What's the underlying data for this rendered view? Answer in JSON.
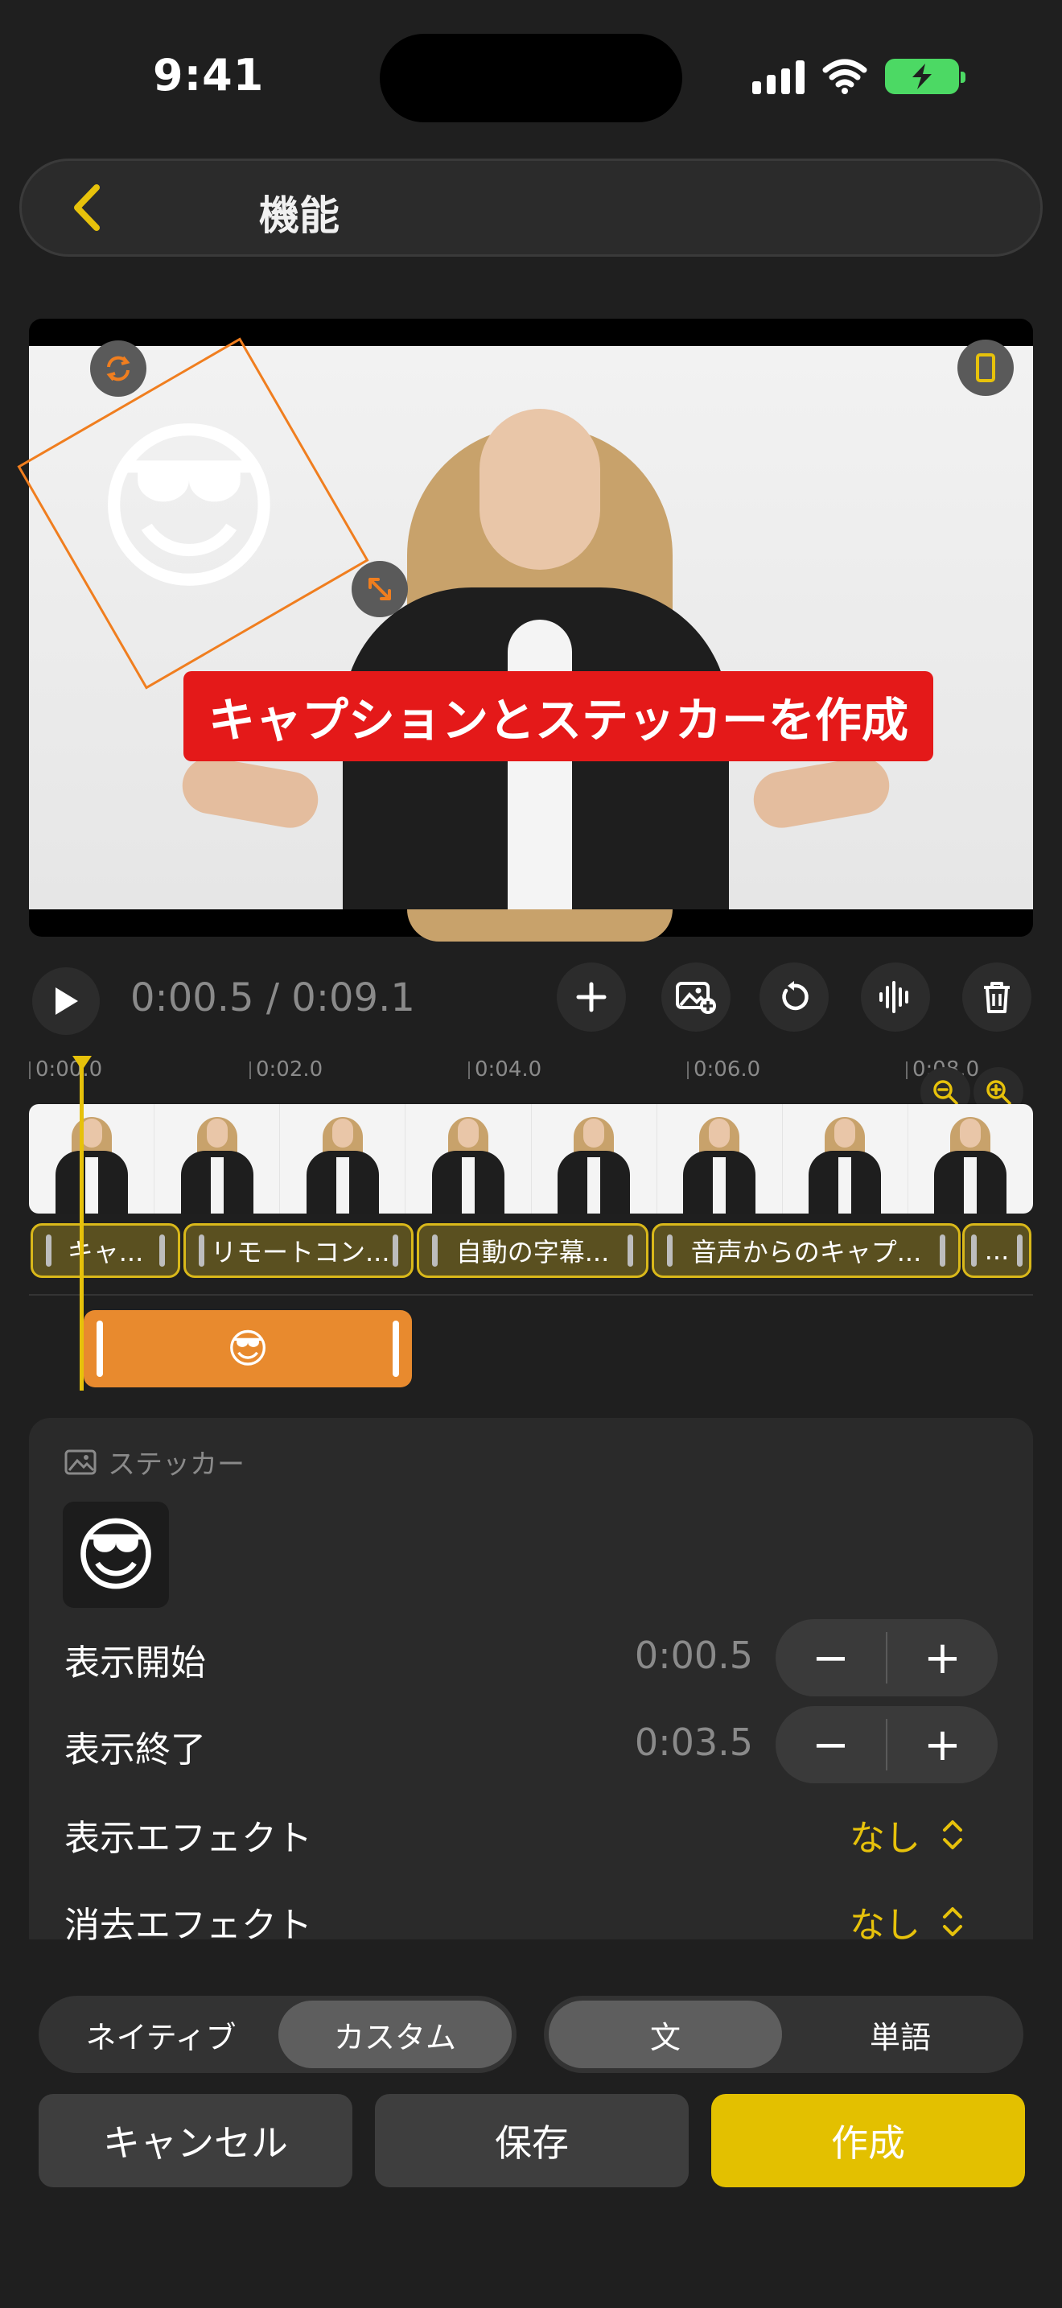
{
  "status_bar": {
    "time": "9:41",
    "icons": [
      "signal-icon",
      "wifi-icon",
      "battery-charging-icon"
    ]
  },
  "header": {
    "title": "機能",
    "back_icon": "chevron-left-icon"
  },
  "preview": {
    "caption_text": "キャプションとステッカーを作成",
    "sticker_emoji": "😎",
    "controls": [
      "rotate-icon",
      "resize-icon",
      "aspect-ratio-icon"
    ]
  },
  "playback": {
    "time_readout": "0:00.5 / 0:09.1",
    "tools": [
      "play-icon",
      "plus-icon",
      "add-image-icon",
      "undo-icon",
      "waveform-icon",
      "trash-icon"
    ]
  },
  "timeline": {
    "ticks": [
      "0:00.0",
      "0:02.0",
      "0:04.0",
      "0:06.0",
      "0:08.0"
    ],
    "caption_clips": [
      "キャ...",
      "リモートコン...",
      "自動の字幕...",
      "音声からのキャプ...",
      "..."
    ],
    "sticker_clip_emoji": "😎",
    "frame_count": 8
  },
  "sticker_panel": {
    "title": "ステッカー",
    "emoji": "😎",
    "start": {
      "label": "表示開始",
      "value": "0:00.5",
      "minus": "−",
      "plus": "+"
    },
    "end": {
      "label": "表示終了",
      "value": "0:03.5",
      "minus": "−",
      "plus": "+"
    },
    "show_effect": {
      "label": "表示エフェクト",
      "value": "なし"
    },
    "hide_effect": {
      "label": "消去エフェクト",
      "value": "なし"
    }
  },
  "mode_segment": {
    "options": [
      "ネイティブ",
      "カスタム"
    ],
    "selected": "カスタム"
  },
  "unit_segment": {
    "options": [
      "文",
      "単語"
    ],
    "selected": "文"
  },
  "actions": {
    "cancel": "キャンセル",
    "save": "保存",
    "create": "作成"
  },
  "colors": {
    "accent": "#e7c20b",
    "caption_bg": "#e41919",
    "sticker_clip": "#e88a2e",
    "background": "#1f1f1f"
  }
}
